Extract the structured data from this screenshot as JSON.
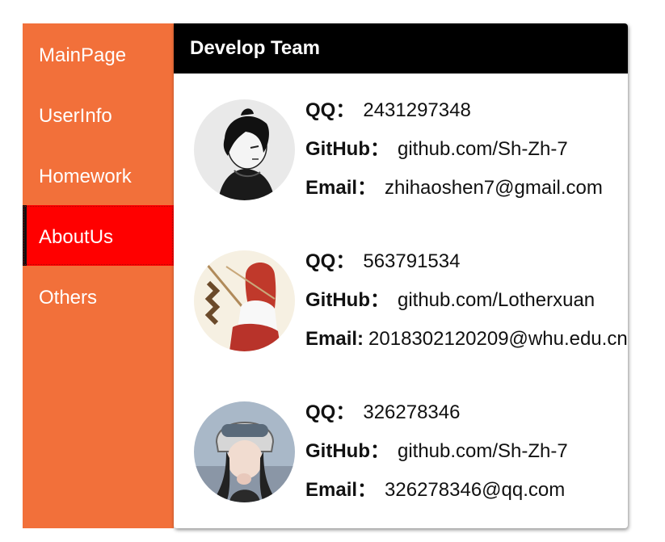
{
  "sidebar": {
    "items": [
      {
        "label": "MainPage"
      },
      {
        "label": "UserInfo"
      },
      {
        "label": "Homework"
      },
      {
        "label": "AboutUs"
      },
      {
        "label": "Others"
      }
    ],
    "active_index": 3
  },
  "card": {
    "title": "Develop Team",
    "members": [
      {
        "avatar_icon": "avatar-sketch-icon",
        "qq_label": "QQ：",
        "qq": "2431297348",
        "github_label": "GitHub：",
        "github": "github.com/Sh-Zh-7",
        "email_label": "Email：",
        "email": "zhihaoshen7@gmail.com"
      },
      {
        "avatar_icon": "avatar-anime-icon",
        "qq_label": "QQ：",
        "qq": "563791534",
        "github_label": "GitHub：",
        "github": "github.com/Lotherxuan",
        "email_label": "Email:",
        "email": "2018302120209@whu.edu.cn"
      },
      {
        "avatar_icon": "avatar-photo-icon",
        "qq_label": "QQ：",
        "qq": "326278346",
        "github_label": "GitHub：",
        "github": "github.com/Sh-Zh-7",
        "email_label": "Email：",
        "email": "326278346@qq.com"
      }
    ]
  },
  "colors": {
    "sidebar_bg": "#f2703a",
    "active_bg": "#ff0000",
    "header_bg": "#000000"
  }
}
